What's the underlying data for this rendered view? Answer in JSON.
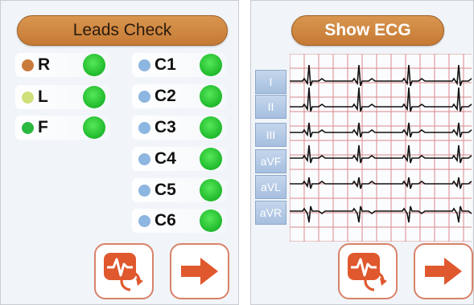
{
  "leads_check": {
    "title": "Leads Check",
    "limb_leads": [
      {
        "label": "R",
        "color": "#c97b3c"
      },
      {
        "label": "L",
        "color": "#cfe07a"
      },
      {
        "label": "F",
        "color": "#2bb840"
      }
    ],
    "chest_leads": [
      {
        "label": "C1",
        "color": "#8db6e0"
      },
      {
        "label": "C2",
        "color": "#8db6e0"
      },
      {
        "label": "C3",
        "color": "#8db6e0"
      },
      {
        "label": "C4",
        "color": "#8db6e0"
      },
      {
        "label": "C5",
        "color": "#8db6e0"
      },
      {
        "label": "C6",
        "color": "#8db6e0"
      }
    ],
    "status_color": "#22c02e"
  },
  "show_ecg": {
    "title": "Show ECG",
    "leads": [
      "I",
      "II",
      "III",
      "aVF",
      "aVL",
      "aVR"
    ]
  },
  "icons": {
    "ecg_refresh": "ecg-refresh-icon",
    "next": "arrow-right-icon"
  },
  "colors": {
    "title_pill": "#c97b3c",
    "grid_line": "#d9898a",
    "button_border": "#d9826a",
    "icon_fill": "#e0582e"
  }
}
